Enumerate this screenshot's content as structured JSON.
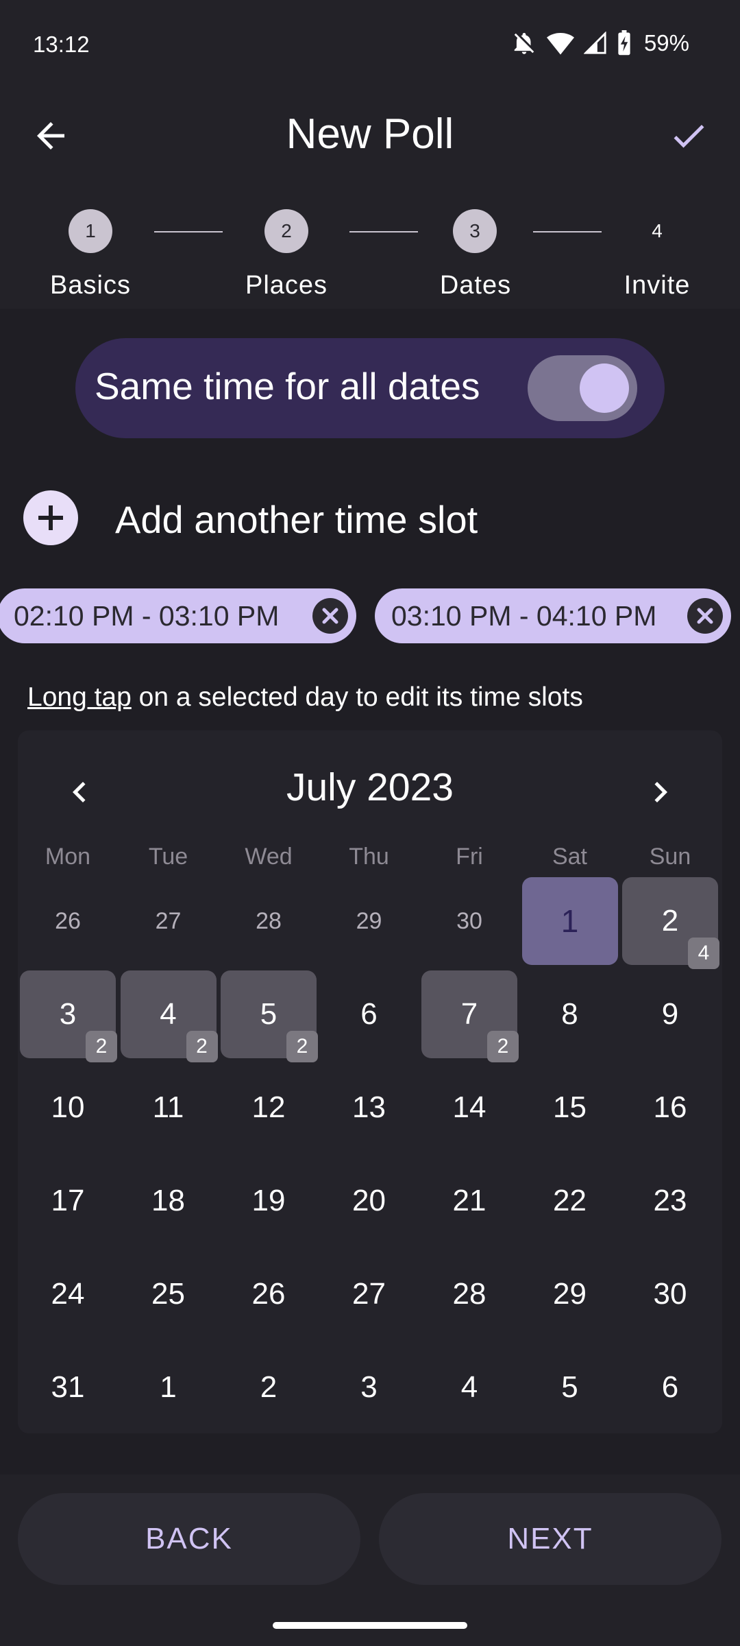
{
  "status": {
    "time": "13:12",
    "battery": "59%"
  },
  "header": {
    "title": "New Poll"
  },
  "stepper": {
    "steps": [
      {
        "number": "1",
        "label": "Basics"
      },
      {
        "number": "2",
        "label": "Places"
      },
      {
        "number": "3",
        "label": "Dates"
      },
      {
        "number": "4",
        "label": "Invite"
      }
    ]
  },
  "same_time": {
    "label": "Same time for all dates",
    "enabled": true
  },
  "add_slot": {
    "label": "Add another time slot"
  },
  "time_slots": [
    {
      "label": "02:10 PM - 03:10 PM"
    },
    {
      "label": "03:10 PM - 04:10 PM"
    }
  ],
  "hint": {
    "link": "Long tap",
    "text": " on a selected day to edit its time slots"
  },
  "calendar": {
    "month": "July 2023",
    "weekdays": [
      "Mon",
      "Tue",
      "Wed",
      "Thu",
      "Fri",
      "Sat",
      "Sun"
    ],
    "weeks": [
      [
        {
          "d": "26",
          "out": true
        },
        {
          "d": "27",
          "out": true
        },
        {
          "d": "28",
          "out": true
        },
        {
          "d": "29",
          "out": true
        },
        {
          "d": "30",
          "out": true
        },
        {
          "d": "1",
          "sel": "primary"
        },
        {
          "d": "2",
          "sel": "yes",
          "badge": "4"
        }
      ],
      [
        {
          "d": "3",
          "sel": "yes",
          "badge": "2"
        },
        {
          "d": "4",
          "sel": "yes",
          "badge": "2"
        },
        {
          "d": "5",
          "sel": "yes",
          "badge": "2"
        },
        {
          "d": "6"
        },
        {
          "d": "7",
          "sel": "yes",
          "badge": "2"
        },
        {
          "d": "8"
        },
        {
          "d": "9"
        }
      ],
      [
        {
          "d": "10"
        },
        {
          "d": "11"
        },
        {
          "d": "12"
        },
        {
          "d": "13"
        },
        {
          "d": "14"
        },
        {
          "d": "15"
        },
        {
          "d": "16"
        }
      ],
      [
        {
          "d": "17"
        },
        {
          "d": "18"
        },
        {
          "d": "19"
        },
        {
          "d": "20"
        },
        {
          "d": "21"
        },
        {
          "d": "22"
        },
        {
          "d": "23"
        }
      ],
      [
        {
          "d": "24"
        },
        {
          "d": "25"
        },
        {
          "d": "26"
        },
        {
          "d": "27"
        },
        {
          "d": "28"
        },
        {
          "d": "29"
        },
        {
          "d": "30"
        }
      ],
      [
        {
          "d": "31"
        },
        {
          "d": "1"
        },
        {
          "d": "2"
        },
        {
          "d": "3"
        },
        {
          "d": "4"
        },
        {
          "d": "5"
        },
        {
          "d": "6"
        }
      ]
    ]
  },
  "buttons": {
    "back": "BACK",
    "next": "NEXT"
  },
  "colors": {
    "accent": "#d0c3f3",
    "background": "#1f1e24",
    "selected_day": "#57545e"
  }
}
